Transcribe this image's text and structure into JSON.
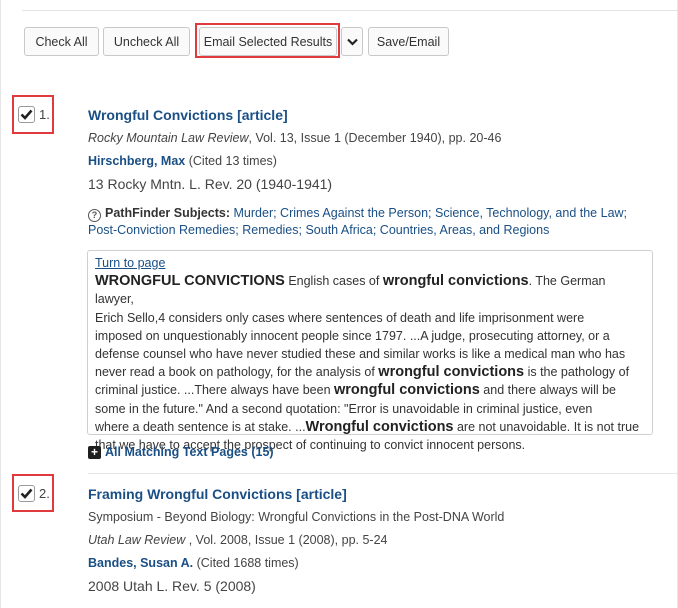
{
  "toolbar": {
    "check_all": "Check All",
    "uncheck_all": "Uncheck All",
    "email_selected": "Email Selected Results",
    "save_email": "Save/Email"
  },
  "results": [
    {
      "number": "1.",
      "checked": true,
      "title": "Wrongful Convictions [article]",
      "journal": "Rocky Mountain Law Review",
      "journal_details": ", Vol. 13, Issue 1 (December 1940), pp. 20-46",
      "author": "Hirschberg, Max",
      "cited": " (Cited 13 times)",
      "citation": "13 Rocky Mntn. L. Rev. 20 (1940-1941)",
      "subjects_label": "PathFinder Subjects:",
      "subjects_line1": "Murder; Crimes Against the Person; Science, Technology, and the Law;",
      "subjects_line2": "Post-Conviction Remedies; Remedies; South Africa; Countries, Areas, and Regions",
      "turn_to_page": "Turn to page",
      "snippet": {
        "l1_b": "WRONGFUL CONVICTIONS",
        "l1_a": " English cases of ",
        "l1_b2": "wrongful convictions",
        "l1_c": ". The German lawyer,",
        "l2": "Erich Sello,4 considers only cases where sentences of death and life imprisonment were",
        "l3": "imposed on unquestionably innocent people since 1797. ...A judge, prosecuting attorney, or a",
        "l4": "defense counsel who have never studied these and similar works is like a medical man who has",
        "l5_a": "never read a book on pathology, for the analysis of ",
        "l5_b": "wrongful convictions",
        "l5_c": " is the pathology of",
        "l6_a": "criminal justice. ...There always have been ",
        "l6_b": "wrongful convictions",
        "l6_c": " and there always will be",
        "l7": "some in the future.\" And a second quotation: \"Error is unavoidable in criminal justice, even",
        "l8_a": "where a death sentence is at stake. ...",
        "l8_b": "Wrongful convictions",
        "l8_c": " are not unavoidable. It is not true",
        "l9": "that we have to accept the prospect of continuing to convict innocent persons."
      },
      "all_matching": "All Matching Text Pages (15)"
    },
    {
      "number": "2.",
      "checked": true,
      "title": "Framing Wrongful Convictions [article]",
      "symposium": "Symposium - Beyond Biology: Wrongful Convictions in the Post-DNA World",
      "journal": "Utah Law Review",
      "journal_details": " , Vol. 2008, Issue 1 (2008), pp. 5-24",
      "author": "Bandes, Susan A.",
      "cited": " (Cited 1688 times)",
      "citation": "2008 Utah L. Rev. 5 (2008)"
    }
  ],
  "colors": {
    "link": "#1a4f86",
    "highlight": "#e0393e"
  }
}
